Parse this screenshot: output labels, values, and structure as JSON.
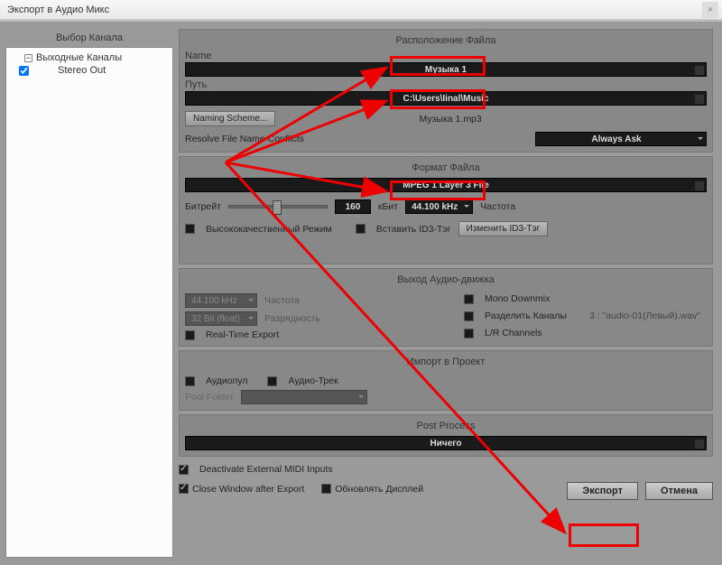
{
  "window": {
    "title": "Экспорт в Аудио Микс"
  },
  "sidebar": {
    "title": "Выбор Канала",
    "root_label": "Выходные Каналы",
    "item_label": "Stereo Out"
  },
  "location": {
    "title": "Расположение Файла",
    "name_label": "Name",
    "name_value": "Музыка 1",
    "path_label": "Путь",
    "path_value": "C:\\Users\\Iinal\\Music",
    "naming_scheme_btn": "Naming Scheme...",
    "filename_preview": "Музыка 1.mp3",
    "conflicts_label": "Resolve File Name Conflicts",
    "conflicts_value": "Always Ask"
  },
  "format": {
    "title": "Формат Файла",
    "type_value": "MPEG 1 Layer 3 File",
    "bitrate_label": "Битрейт",
    "bitrate_value": "160",
    "kbit_label": "кБит",
    "samplerate_value": "44.100 kHz",
    "samplerate_label": "Частота",
    "hq_label": "Высококачественный Режим",
    "id3_insert_label": "Вставить ID3-Тэг",
    "id3_edit_btn": "Изменить ID3-Тэг"
  },
  "engine": {
    "title": "Выход Аудио-движка",
    "sr_value": "44.100 kHz",
    "sr_label": "Частота",
    "bit_value": "32 Bit (float)",
    "bit_label": "Разрядность",
    "realtime_label": "Real-Time Export",
    "mono_label": "Mono Downmix",
    "split_label": "Разделить Каналы",
    "split_info": "3 : \"audio-01(Левый).wav\"",
    "lr_label": "L/R Channels"
  },
  "import": {
    "title": "Импорт в Проект",
    "pool_label": "Аудиопул",
    "track_label": "Аудио-Трек",
    "folder_label": "Pool Folder"
  },
  "post": {
    "title": "Post Process",
    "value": "Ничего"
  },
  "footer": {
    "midi_label": "Deactivate External MIDI Inputs",
    "close_label": "Close Window after Export",
    "update_label": "Обновлять Дисплей",
    "export_btn": "Экспорт",
    "cancel_btn": "Отмена"
  }
}
